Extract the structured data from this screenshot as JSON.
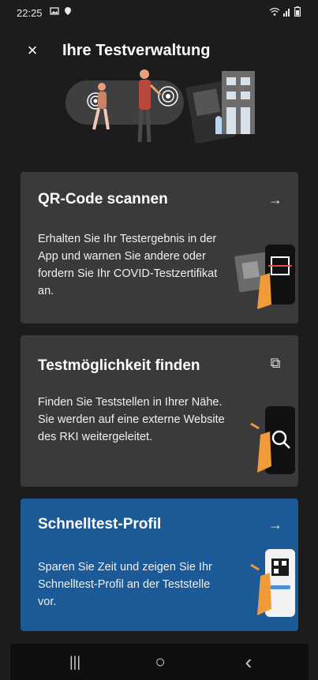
{
  "status_bar": {
    "time": "22:25",
    "left_icons": [
      "gallery-icon",
      "location-icon"
    ],
    "right_icons": [
      "wifi-icon",
      "signal-icon",
      "battery-icon"
    ]
  },
  "header": {
    "close_label": "×",
    "title": "Ihre Testverwaltung"
  },
  "cards": [
    {
      "title": "QR-Code scannen",
      "description": "Erhalten Sie Ihr Testergebnis in der App und warnen Sie andere oder fordern Sie Ihr COVID-Testzertifikat an.",
      "action_icon": "arrow-right-icon",
      "action_glyph": "→"
    },
    {
      "title": "Testmöglichkeit finden",
      "description": "Finden Sie Teststellen in Ihrer Nähe. Sie werden auf eine externe Website des RKI weitergeleitet.",
      "action_icon": "external-link-icon",
      "action_glyph": "⧉"
    },
    {
      "title": "Schnelltest-Profil",
      "description": "Sparen Sie Zeit und zeigen Sie Ihr Schnelltest-Profil an der Teststelle vor.",
      "action_icon": "arrow-right-icon",
      "action_glyph": "→"
    }
  ],
  "nav_bar": {
    "recents_glyph": "|||",
    "home_glyph": "○",
    "back_glyph": "‹"
  },
  "colors": {
    "background": "#1c1c1c",
    "card": "#3a3a3a",
    "accent_card": "#1b5a96"
  }
}
